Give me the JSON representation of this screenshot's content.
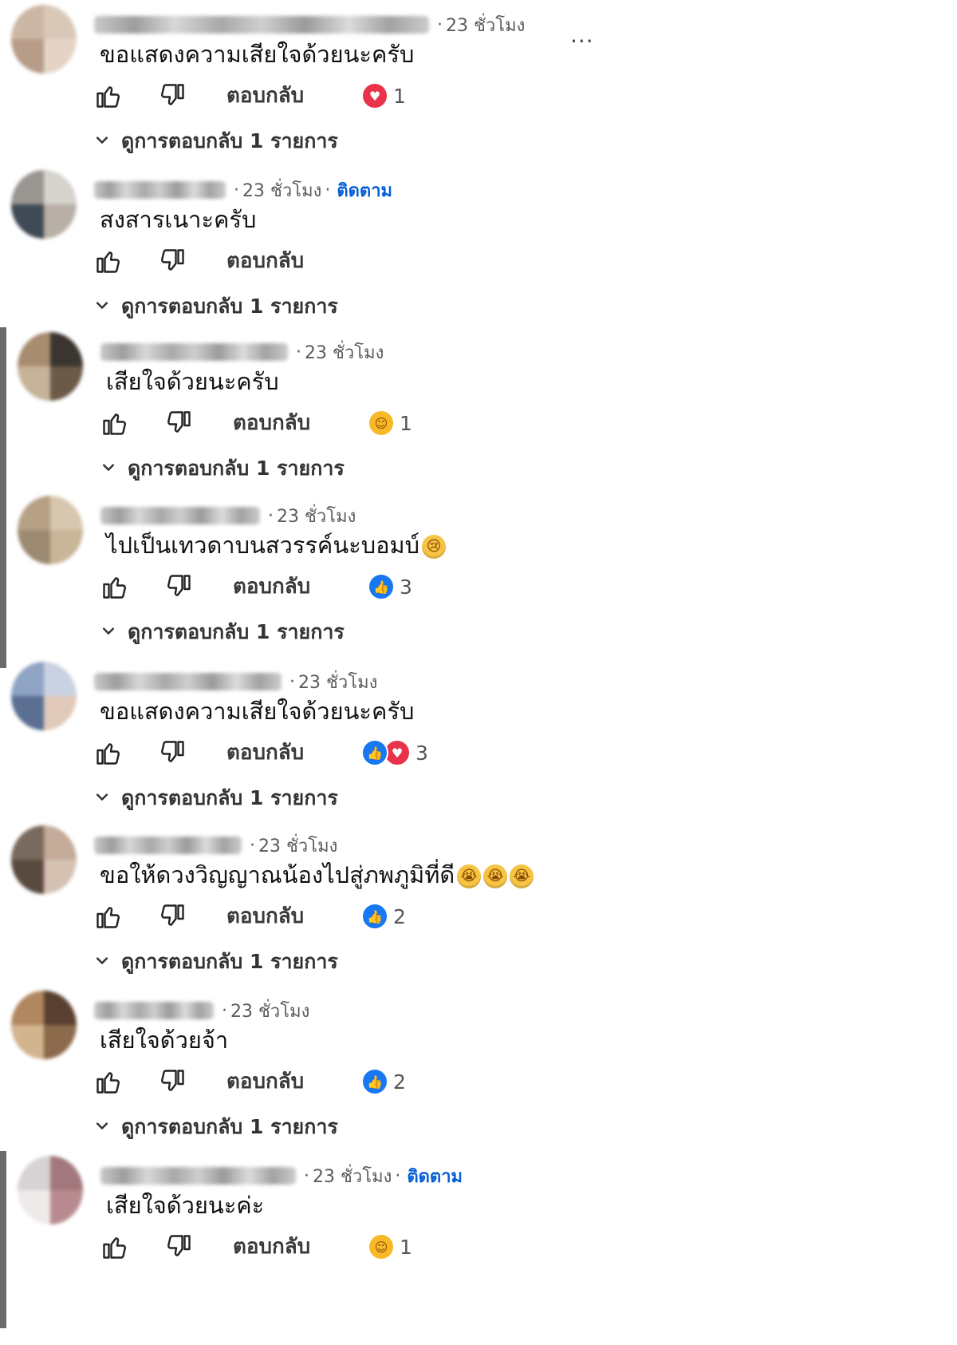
{
  "comments": [
    {
      "time": "23 ชั่วโมง",
      "follow": "",
      "text": "ขอแสดงความเสียใจด้วยนะครับ",
      "emoji": [],
      "reply_label": "ตอบกลับ",
      "reactions": [
        "love"
      ],
      "reaction_count": "1",
      "view_replies": "ดูการตอบกลับ 1 รายการ",
      "more": "...",
      "avatar_colors": [
        "#cbb7a3",
        "#d9c8b8",
        "#b79c88",
        "#e4d4c5"
      ]
    },
    {
      "time": "23 ชั่วโมง",
      "follow": "ติดตาม",
      "text": "สงสารเนาะครับ",
      "emoji": [],
      "reply_label": "ตอบกลับ",
      "reactions": [],
      "reaction_count": "",
      "view_replies": "ดูการตอบกลับ 1 รายการ",
      "more": "",
      "avatar_colors": [
        "#9a9590",
        "#d6d2cc",
        "#3e4a55",
        "#b8b0a6"
      ]
    },
    {
      "time": "23 ชั่วโมง",
      "follow": "",
      "text": "เสียใจด้วยนะครับ",
      "emoji": [],
      "reply_label": "ตอบกลับ",
      "reactions": [
        "care"
      ],
      "reaction_count": "1",
      "view_replies": "ดูการตอบกลับ 1 รายการ",
      "more": "",
      "avatar_colors": [
        "#a88c6f",
        "#3b3530",
        "#c7b39a",
        "#6b5a48"
      ]
    },
    {
      "time": "23 ชั่วโมง",
      "follow": "",
      "text": "ไปเป็นเทวดาบนสวรรค์นะบอมบ์",
      "emoji": [
        "😢"
      ],
      "reply_label": "ตอบกลับ",
      "reactions": [
        "like"
      ],
      "reaction_count": "3",
      "view_replies": "ดูการตอบกลับ 1 รายการ",
      "more": "",
      "avatar_colors": [
        "#b7a184",
        "#d8c7af",
        "#9c8a72",
        "#c9b598"
      ]
    },
    {
      "time": "23 ชั่วโมง",
      "follow": "",
      "text": "ขอแสดงความเสียใจด้วยนะครับ",
      "emoji": [],
      "reply_label": "ตอบกลับ",
      "reactions": [
        "like",
        "love"
      ],
      "reaction_count": "3",
      "view_replies": "ดูการตอบกลับ 1 รายการ",
      "more": "",
      "avatar_colors": [
        "#8fa3c4",
        "#c9d2e2",
        "#5b6f93",
        "#e0c9b8"
      ]
    },
    {
      "time": "23 ชั่วโมง",
      "follow": "",
      "text": "ขอให้ดวงวิญญาณน้องไปสู่ภพภูมิที่ดี",
      "emoji": [
        "😭",
        "😭",
        "😭"
      ],
      "reply_label": "ตอบกลับ",
      "reactions": [
        "like"
      ],
      "reaction_count": "2",
      "view_replies": "ดูการตอบกลับ 1 รายการ",
      "more": "",
      "avatar_colors": [
        "#7a6a5e",
        "#c3aa99",
        "#5a4b40",
        "#d6c2b3"
      ]
    },
    {
      "time": "23 ชั่วโมง",
      "follow": "",
      "text": "เสียใจด้วยจ้า",
      "emoji": [],
      "reply_label": "ตอบกลับ",
      "reactions": [
        "like"
      ],
      "reaction_count": "2",
      "view_replies": "ดูการตอบกลับ 1 รายการ",
      "more": "",
      "avatar_colors": [
        "#b0875f",
        "#5a4030",
        "#d2b48f",
        "#8c6a4c"
      ]
    },
    {
      "time": "23 ชั่วโมง",
      "follow": "ติดตาม",
      "text": "เสียใจด้วยนะค่ะ",
      "emoji": [],
      "reply_label": "ตอบกลับ",
      "reactions": [
        "care"
      ],
      "reaction_count": "1",
      "view_replies": "",
      "more": "",
      "avatar_colors": [
        "#d7d2d3",
        "#a2787c",
        "#efeaea",
        "#b98b90"
      ]
    }
  ],
  "icons": {
    "like": "thumb-up-outline-icon",
    "dislike": "thumb-down-outline-icon",
    "chevron": "chevron-down-icon",
    "reaction_like": "like-reaction-icon",
    "reaction_love": "love-reaction-icon",
    "reaction_care": "care-reaction-icon"
  },
  "colors": {
    "follow": "#065fd4",
    "like_reaction": "#1877f2",
    "love_reaction": "#e8334a",
    "care_reaction": "#f7b928"
  }
}
